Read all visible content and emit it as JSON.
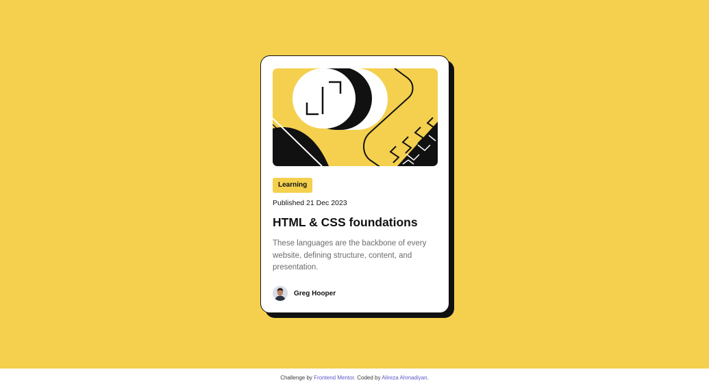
{
  "card": {
    "category": "Learning",
    "published": "Published 21 Dec 2023",
    "title": "HTML & CSS foundations",
    "description": "These languages are the backbone of every website, defining structure, content, and presentation.",
    "author": {
      "name": "Greg Hooper"
    }
  },
  "footer": {
    "prefix": "Challenge by ",
    "challenge_link": "Frontend Mentor",
    "middle": ". Coded by ",
    "author_link": "Alireza Ahmadiyan",
    "suffix": "."
  },
  "colors": {
    "background": "#f4d04e",
    "card": "#ffffff",
    "ink": "#111111",
    "muted_text": "#6b6b6b",
    "link": "#5b57c9"
  },
  "icons": [
    "illustration-article",
    "author-avatar"
  ]
}
